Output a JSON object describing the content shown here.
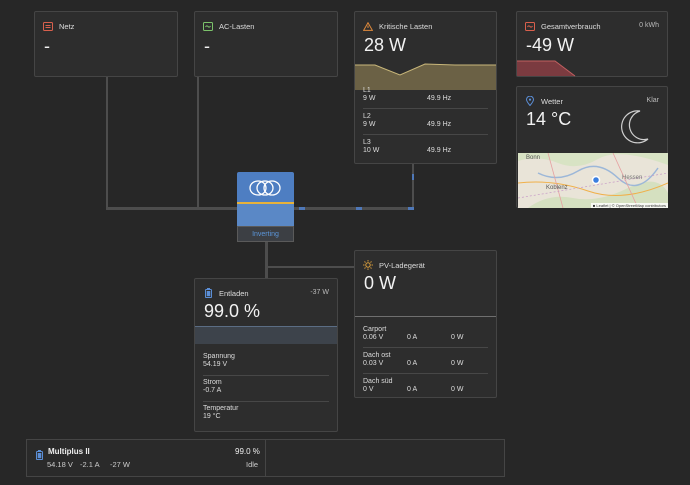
{
  "netz": {
    "title": "Netz",
    "value": "-"
  },
  "ac_lasten": {
    "title": "AC-Lasten",
    "value": "-"
  },
  "kritische": {
    "title": "Kritische Lasten",
    "value": "28 W",
    "phases": [
      {
        "label": "L1",
        "power": "9 W",
        "freq": "49.9 Hz"
      },
      {
        "label": "L2",
        "power": "9 W",
        "freq": "49.9 Hz"
      },
      {
        "label": "L3",
        "power": "10 W",
        "freq": "49.9 Hz"
      }
    ]
  },
  "gesamt": {
    "title": "Gesamtverbrauch",
    "value": "-49 W",
    "energy": "0 kWh"
  },
  "wetter": {
    "title": "Wetter",
    "value": "14 °C",
    "condition": "Klar",
    "map": {
      "label_bonn": "Bonn",
      "label_koblenz": "Koblenz",
      "label_hessen": "Hessen",
      "attribution": "■ Leaflet | © OpenStreetMap contributors"
    }
  },
  "inverter": {
    "status": "Inverting"
  },
  "battery": {
    "title": "Entladen",
    "power": "-37 W",
    "soc": "99.0 %",
    "rows": [
      {
        "label": "Spannung",
        "value": "54.19 V"
      },
      {
        "label": "Strom",
        "value": "-0.7 A"
      },
      {
        "label": "Temperatur",
        "value": "19 °C"
      }
    ]
  },
  "pv": {
    "title": "PV-Ladegerät",
    "value": "0 W",
    "rows": [
      {
        "label": "Carport",
        "v": "0.06 V",
        "a": "0 A",
        "w": "0 W"
      },
      {
        "label": "Dach ost",
        "v": "0.03 V",
        "a": "0 A",
        "w": "0 W"
      },
      {
        "label": "Dach süd",
        "v": "0 V",
        "a": "0 A",
        "w": "0 W"
      }
    ]
  },
  "multiplus": {
    "name": "Multiplus II",
    "soc": "99.0 %",
    "voltage": "54.18 V",
    "current": "-2.1 A",
    "power": "-27 W",
    "state": "Idle"
  },
  "colors": {
    "background": "#272727",
    "card": "#2d2d2d",
    "accent_blue": "#4f78b8",
    "critical_area": "#6b6145",
    "consumption_area": "#7b3b40"
  }
}
